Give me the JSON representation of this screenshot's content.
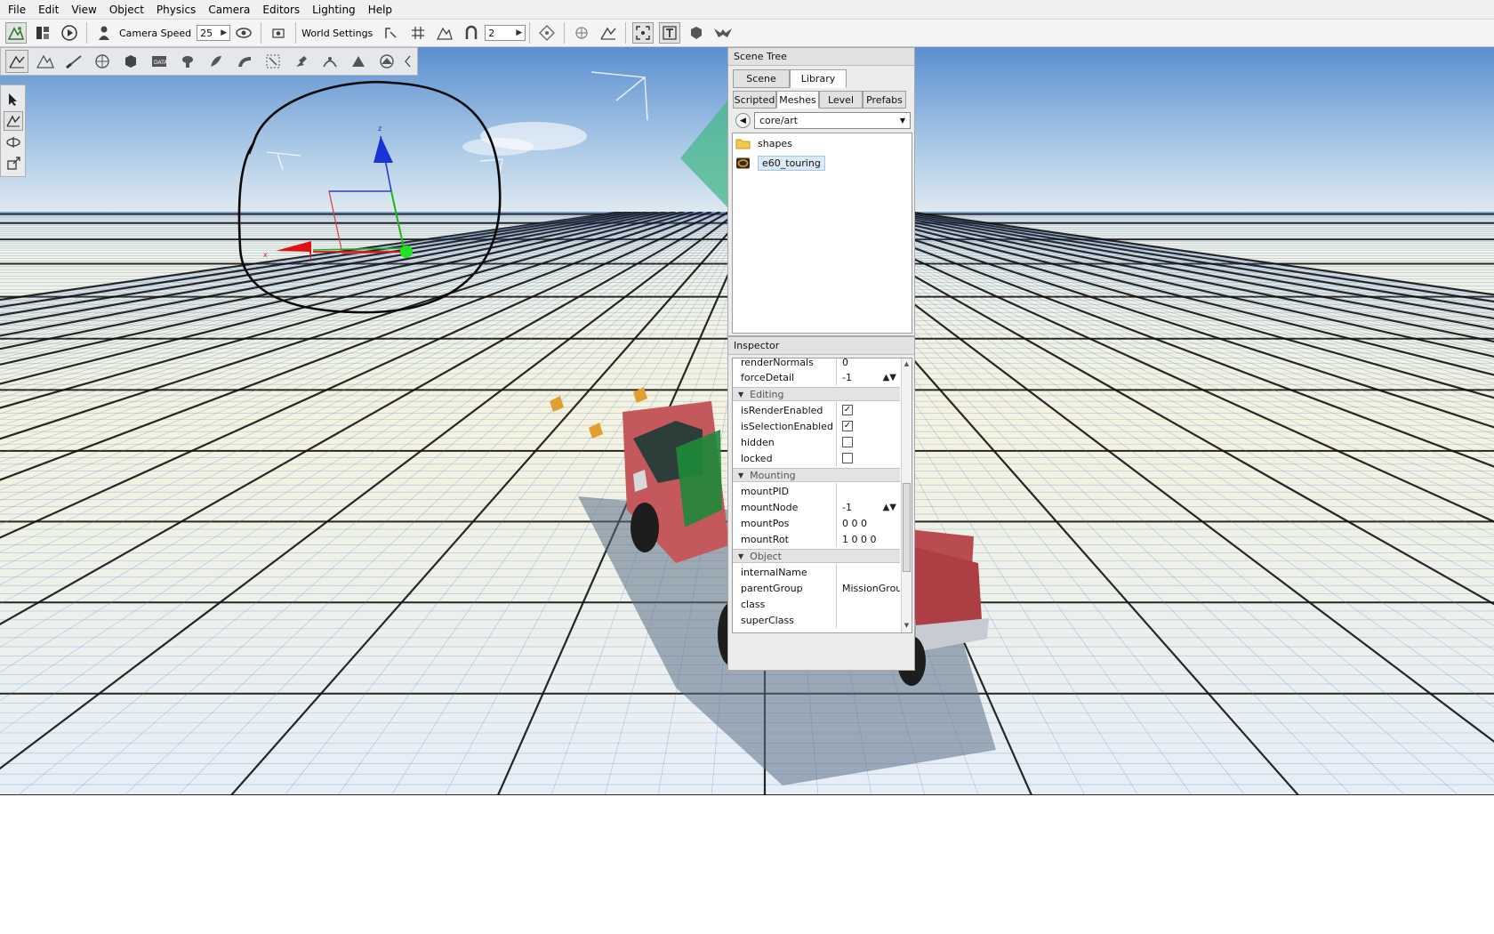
{
  "menu": [
    "File",
    "Edit",
    "View",
    "Object",
    "Physics",
    "Camera",
    "Editors",
    "Lighting",
    "Help"
  ],
  "toolbar": {
    "camera_speed_label": "Camera Speed",
    "camera_speed_value": "25",
    "world_settings_label": "World Settings",
    "snap_value": "2"
  },
  "scene_tree": {
    "title": "Scene Tree",
    "tabs": [
      "Scene",
      "Library"
    ],
    "active_tab": "Library",
    "subtabs": [
      "Scripted",
      "Meshes",
      "Level",
      "Prefabs"
    ],
    "active_subtab": "Meshes",
    "path": "core/art",
    "items": [
      {
        "label": "shapes",
        "icon": "folder-icon"
      },
      {
        "label": "e60_touring",
        "icon": "mesh-icon"
      }
    ]
  },
  "inspector": {
    "title": "Inspector",
    "top_rows": [
      {
        "key": "renderNormals",
        "value": "0"
      },
      {
        "key": "forceDetail",
        "value": "-1"
      }
    ],
    "editing": {
      "label": "Editing",
      "rows": [
        {
          "key": "isRenderEnabled",
          "checked": "✓"
        },
        {
          "key": "isSelectionEnabled",
          "checked": "✓"
        },
        {
          "key": "hidden",
          "checked": ""
        },
        {
          "key": "locked",
          "checked": ""
        }
      ]
    },
    "mounting": {
      "label": "Mounting",
      "rows": [
        {
          "key": "mountPID",
          "value": ""
        },
        {
          "key": "mountNode",
          "value": "-1"
        },
        {
          "key": "mountPos",
          "value": "0 0 0"
        },
        {
          "key": "mountRot",
          "value": "1 0 0 0"
        }
      ]
    },
    "object": {
      "label": "Object",
      "rows": [
        {
          "key": "internalName",
          "value": ""
        },
        {
          "key": "parentGroup",
          "value": "MissionGrou"
        },
        {
          "key": "class",
          "value": ""
        },
        {
          "key": "superClass",
          "value": ""
        }
      ]
    }
  },
  "colors": {
    "sky_top": "#5a8fcf",
    "sky_bottom": "#eef3f5",
    "grid_major": "#111111",
    "grid_minor": "#5d86c9",
    "gizmo_x": "#e01010",
    "gizmo_y": "#15c015",
    "gizmo_z": "#1030e0",
    "truck_red": "#c8575a",
    "highlight_cyan": "#47b78a"
  }
}
